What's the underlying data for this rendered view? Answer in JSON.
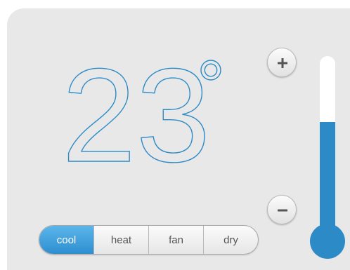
{
  "thermostat": {
    "temperature": "23",
    "unit_symbol": "°",
    "accent_color": "#2c8ac6",
    "level_fraction": 0.65
  },
  "controls": {
    "increase_icon": "plus-icon",
    "decrease_icon": "minus-icon"
  },
  "modes": [
    {
      "label": "cool",
      "active": true
    },
    {
      "label": "heat",
      "active": false
    },
    {
      "label": "fan",
      "active": false
    },
    {
      "label": "dry",
      "active": false
    }
  ]
}
